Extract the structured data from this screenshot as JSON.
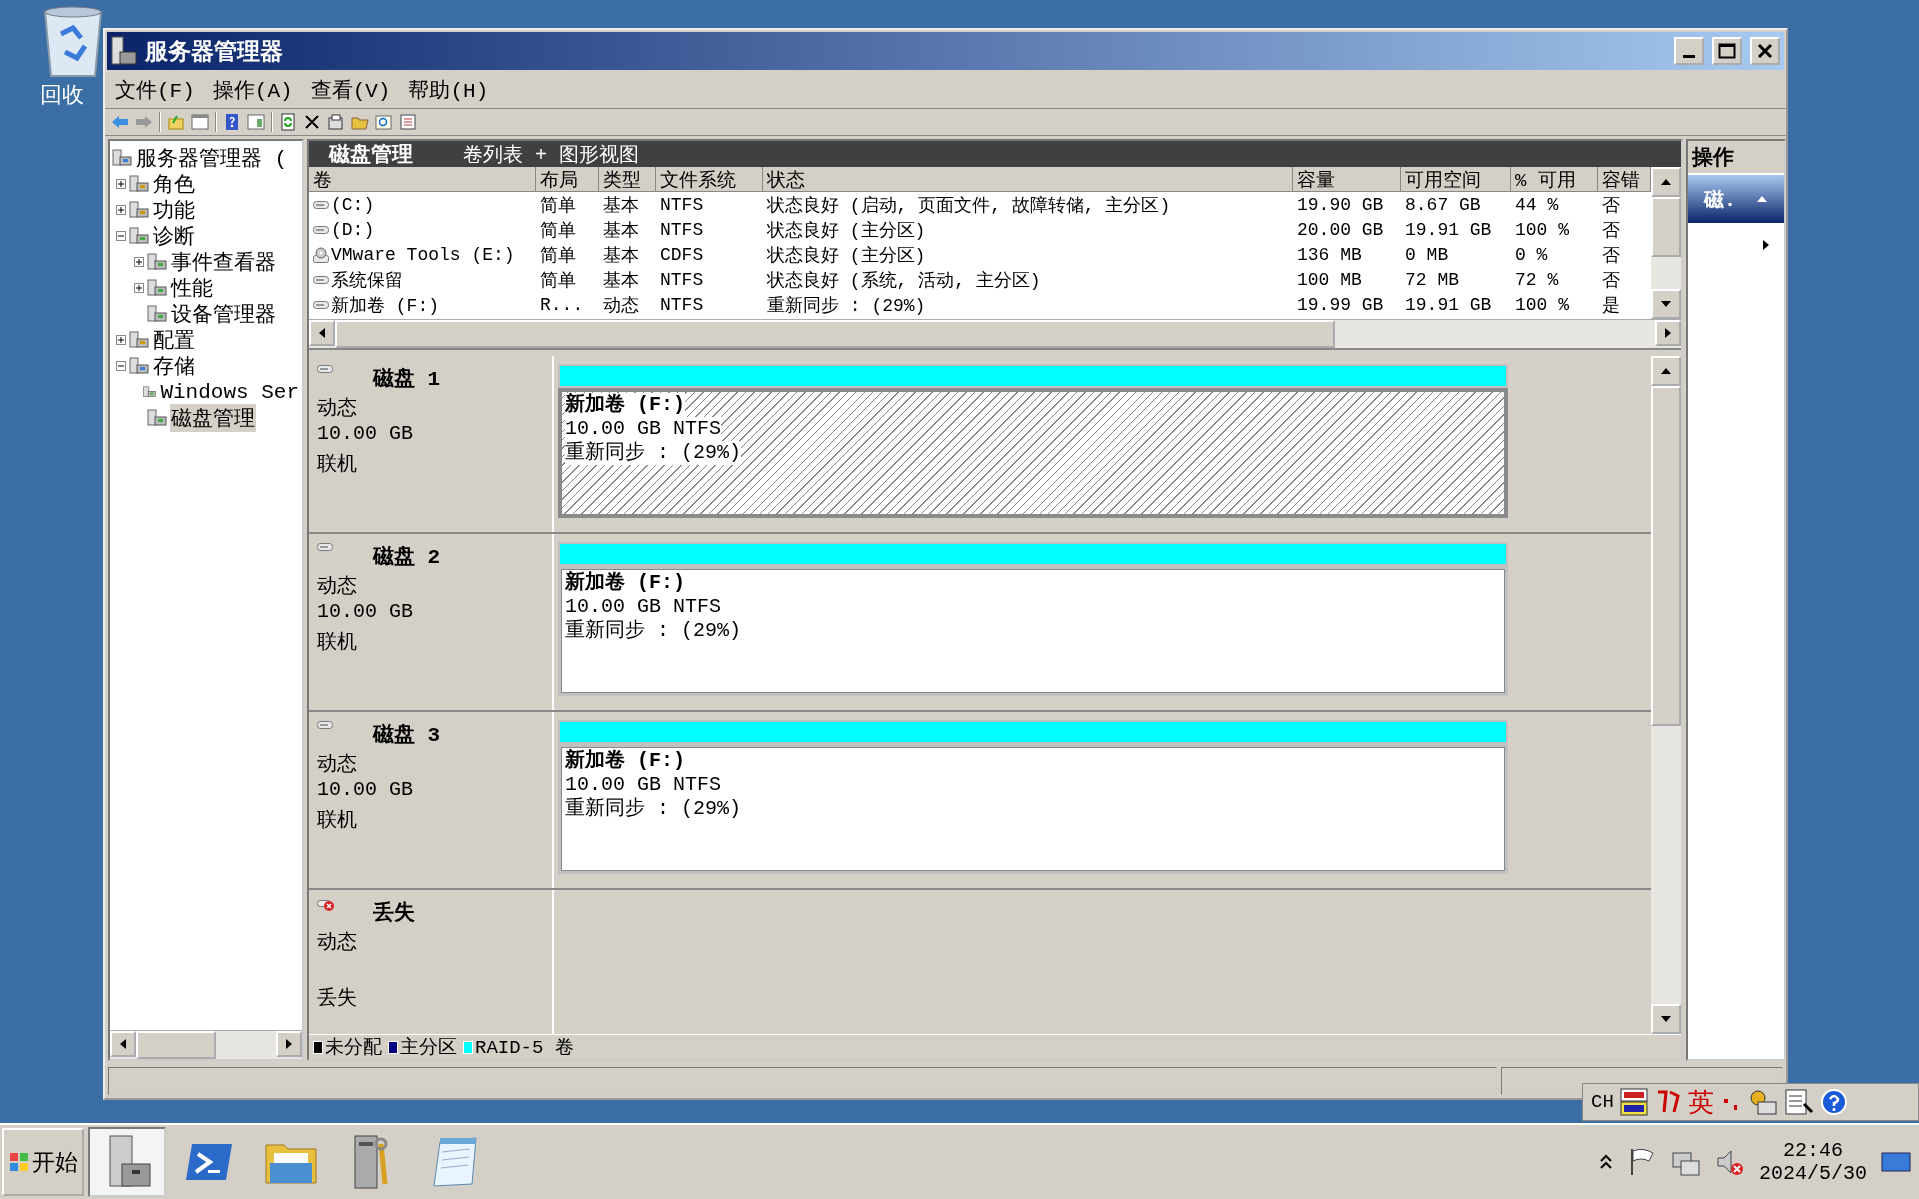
{
  "desktop_icons": [
    {
      "label": "回收"
    }
  ],
  "window": {
    "title": "服务器管理器"
  },
  "menu": [
    "文件(F)",
    "操作(A)",
    "查看(V)",
    "帮助(H)"
  ],
  "tree": {
    "label": "服务器管理器 (",
    "selected": false,
    "children": [
      {
        "label": "角色",
        "expanded": false,
        "selected": false
      },
      {
        "label": "功能",
        "expanded": false,
        "selected": false
      },
      {
        "label": "诊断",
        "expanded": true,
        "selected": false,
        "children": [
          {
            "label": "事件查看器",
            "expanded": false,
            "selected": false
          },
          {
            "label": "性能",
            "expanded": false,
            "selected": false
          },
          {
            "label": "设备管理器",
            "selected": false
          }
        ]
      },
      {
        "label": "配置",
        "expanded": false,
        "selected": false
      },
      {
        "label": "存储",
        "expanded": true,
        "selected": false,
        "children": [
          {
            "label": "Windows Ser",
            "selected": false
          },
          {
            "label": "磁盘管理",
            "selected": true
          }
        ]
      }
    ]
  },
  "panel": {
    "title": "磁盘管理",
    "subtitle": "卷列表 + 图形视图"
  },
  "table": {
    "columns": [
      "卷",
      "布局",
      "类型",
      "文件系统",
      "状态",
      "容量",
      "可用空间",
      "% 可用",
      "容错"
    ],
    "rows": [
      {
        "kind": "disk",
        "cells": [
          " (C:)",
          "简单",
          "基本",
          "NTFS",
          "状态良好 (启动, 页面文件, 故障转储, 主分区)",
          "19.90 GB",
          "8.67 GB",
          "44 %",
          "否"
        ]
      },
      {
        "kind": "disk",
        "cells": [
          " (D:)",
          "简单",
          "基本",
          "NTFS",
          "状态良好 (主分区)",
          "20.00 GB",
          "19.91 GB",
          "100 %",
          "否"
        ]
      },
      {
        "kind": "cdrom",
        "cells": [
          "VMware Tools (E:)",
          "简单",
          "基本",
          "CDFS",
          "状态良好 (主分区)",
          "136 MB",
          "0 MB",
          "0 %",
          "否"
        ]
      },
      {
        "kind": "disk",
        "cells": [
          "系统保留",
          "简单",
          "基本",
          "NTFS",
          "状态良好 (系统, 活动, 主分区)",
          "100 MB",
          "72 MB",
          "72 %",
          "否"
        ]
      },
      {
        "kind": "disk",
        "cells": [
          "新加卷 (F:)",
          "R...",
          "动态",
          "NTFS",
          "重新同步 : (29%)",
          "19.99 GB",
          "19.91 GB",
          "100 %",
          "是"
        ]
      }
    ]
  },
  "disks": [
    {
      "kind": "online",
      "name": "磁盘 1",
      "type": "动态",
      "size": "10.00 GB",
      "status": "联机",
      "volume": {
        "name": "新加卷  (F:)",
        "detail": "10.00 GB NTFS",
        "status": "重新同步 : (29%)",
        "selected": true
      }
    },
    {
      "kind": "online",
      "name": "磁盘 2",
      "type": "动态",
      "size": "10.00 GB",
      "status": "联机",
      "volume": {
        "name": "新加卷  (F:)",
        "detail": "10.00 GB NTFS",
        "status": "重新同步 : (29%)",
        "selected": false
      }
    },
    {
      "kind": "online",
      "name": "磁盘 3",
      "type": "动态",
      "size": "10.00 GB",
      "status": "联机",
      "volume": {
        "name": "新加卷  (F:)",
        "detail": "10.00 GB NTFS",
        "status": "重新同步 : (29%)",
        "selected": false
      }
    },
    {
      "kind": "missing",
      "name": "丢失",
      "type": "动态",
      "status": "丢失"
    }
  ],
  "legend": [
    {
      "label": "未分配",
      "color": "#000000"
    },
    {
      "label": "主分区",
      "color": "#000080"
    },
    {
      "label": "RAID-5 卷",
      "color": "#00ffff"
    }
  ],
  "actions": {
    "title": "操作",
    "section": "磁.",
    "expanded": true
  },
  "language_bar": {
    "language": "CH",
    "mode": "英"
  },
  "taskbar": {
    "start": "开始",
    "apps": [
      {
        "kind": "server",
        "selected": true
      },
      {
        "kind": "shell",
        "selected": false
      },
      {
        "kind": "folder",
        "selected": false
      },
      {
        "kind": "tools",
        "selected": false
      },
      {
        "kind": "notepad",
        "selected": false
      }
    ],
    "time": "22:46",
    "date": "2024/5/30"
  }
}
